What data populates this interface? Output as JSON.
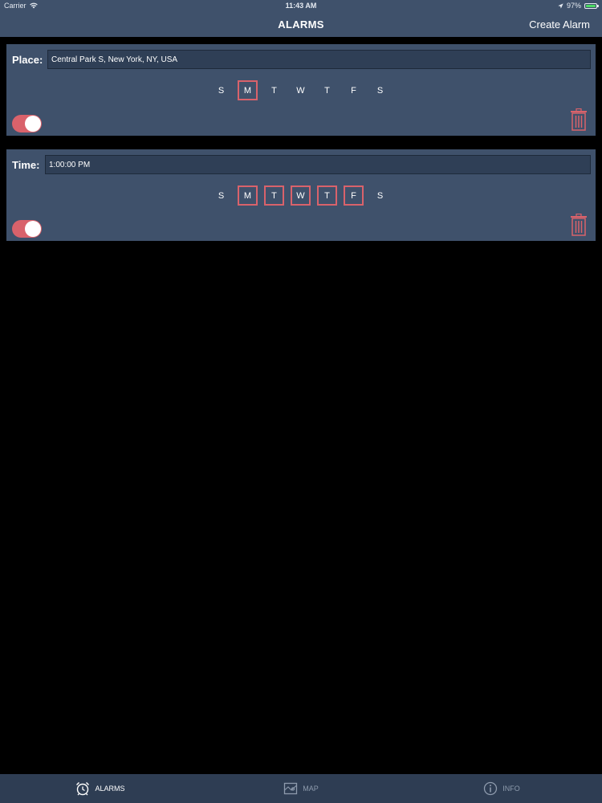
{
  "status_bar": {
    "carrier": "Carrier",
    "time": "11:43 AM",
    "battery": "97%",
    "battery_level": 0.97
  },
  "nav": {
    "title": "ALARMS",
    "action": "Create Alarm"
  },
  "alarms": [
    {
      "label": "Place:",
      "value": "Central Park S, New York, NY, USA",
      "days": [
        {
          "letter": "S",
          "selected": false
        },
        {
          "letter": "M",
          "selected": true
        },
        {
          "letter": "T",
          "selected": false
        },
        {
          "letter": "W",
          "selected": false
        },
        {
          "letter": "T",
          "selected": false
        },
        {
          "letter": "F",
          "selected": false
        },
        {
          "letter": "S",
          "selected": false
        }
      ],
      "enabled": true
    },
    {
      "label": "Time:",
      "value": "1:00:00 PM",
      "days": [
        {
          "letter": "S",
          "selected": false
        },
        {
          "letter": "M",
          "selected": true
        },
        {
          "letter": "T",
          "selected": true
        },
        {
          "letter": "W",
          "selected": true
        },
        {
          "letter": "T",
          "selected": true
        },
        {
          "letter": "F",
          "selected": true
        },
        {
          "letter": "S",
          "selected": false
        }
      ],
      "enabled": true
    }
  ],
  "tabs": [
    {
      "label": "ALARMS",
      "icon": "alarm-clock-icon",
      "active": true
    },
    {
      "label": "MAP",
      "icon": "map-icon",
      "active": false
    },
    {
      "label": "INFO",
      "icon": "info-icon",
      "active": false
    }
  ],
  "colors": {
    "bar": "#3f516b",
    "accent": "#d9626b",
    "background": "#000000"
  }
}
